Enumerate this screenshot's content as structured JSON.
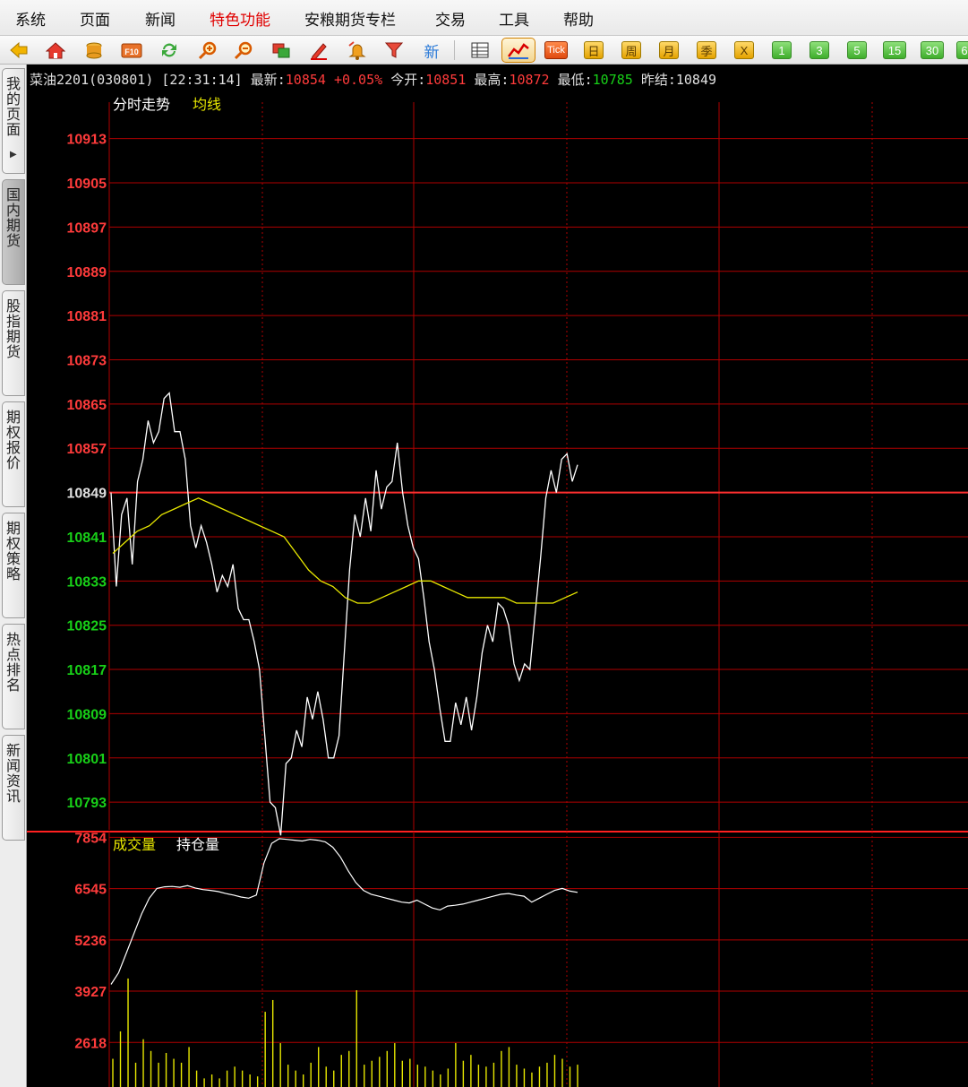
{
  "menu": [
    {
      "label": "系统",
      "highlight": false
    },
    {
      "label": "页面",
      "highlight": false
    },
    {
      "label": "新闻",
      "highlight": false
    },
    {
      "label": "特色功能",
      "highlight": true
    },
    {
      "label": "安粮期货专栏",
      "highlight": false
    },
    {
      "label": "交易",
      "highlight": false
    },
    {
      "label": "工具",
      "highlight": false
    },
    {
      "label": "帮助",
      "highlight": false
    }
  ],
  "toolbar": {
    "icons": [
      "back-arrow-icon",
      "home-icon",
      "database-icon",
      "f10-icon",
      "refresh-icon",
      "zoom-in-icon",
      "zoom-out-icon",
      "window-icon",
      "pencil-icon",
      "bell-icon",
      "filter-icon"
    ],
    "new_label": "新",
    "tick_label": "Tick",
    "periods": [
      "日",
      "周",
      "月",
      "季",
      "X"
    ],
    "minutes": [
      "1",
      "3",
      "5",
      "15",
      "30",
      "6"
    ]
  },
  "sidebar": [
    {
      "label": "我的页面",
      "active": false
    },
    {
      "label": "国内期货",
      "active": true
    },
    {
      "label": "股指期货",
      "active": false
    },
    {
      "label": "期权报价",
      "active": false
    },
    {
      "label": "期权策略",
      "active": false
    },
    {
      "label": "热点排名",
      "active": false
    },
    {
      "label": "新闻资讯",
      "active": false
    }
  ],
  "quote": {
    "name": "菜油2201(030801)",
    "time": "[22:31:14]",
    "latest_label": "最新:",
    "latest": "10854",
    "change": "+0.05%",
    "open_label": "今开:",
    "open": "10851",
    "high_label": "最高:",
    "high": "10872",
    "low_label": "最低:",
    "low": "10785",
    "prev_settle_label": "昨结:",
    "prev_settle": "10849"
  },
  "colors": {
    "grid": "#b00000",
    "price": "#ffffff",
    "avg": "#e8e800",
    "up": "#ff3b3b",
    "down": "#18d018",
    "even": "#e0e0e0"
  },
  "chart_data": [
    {
      "type": "line",
      "legend": [
        "分时走势",
        "均线"
      ],
      "y_ticks": [
        10913,
        10905,
        10897,
        10889,
        10881,
        10873,
        10865,
        10857,
        10849,
        10841,
        10833,
        10825,
        10817,
        10809,
        10801,
        10793
      ],
      "ylim": [
        10788,
        10917
      ],
      "prev_settle": 10849,
      "series": [
        {
          "name": "分时走势",
          "values": [
            10849,
            10832,
            10845,
            10848,
            10836,
            10851,
            10855,
            10862,
            10858,
            10860,
            10866,
            10867,
            10860,
            10860,
            10855,
            10843,
            10839,
            10843,
            10840,
            10836,
            10831,
            10834,
            10832,
            10836,
            10828,
            10826,
            10826,
            10822,
            10817,
            10805,
            10793,
            10792,
            10787,
            10800,
            10801,
            10806,
            10803,
            10812,
            10808,
            10813,
            10808,
            10801,
            10801,
            10805,
            10820,
            10835,
            10845,
            10841,
            10848,
            10842,
            10853,
            10846,
            10850,
            10851,
            10858,
            10849,
            10843,
            10839,
            10837,
            10830,
            10822,
            10817,
            10810,
            10804,
            10804,
            10811,
            10807,
            10812,
            10806,
            10812,
            10820,
            10825,
            10822,
            10829,
            10828,
            10825,
            10818,
            10815,
            10818,
            10817,
            10827,
            10837,
            10848,
            10853,
            10849,
            10855,
            10856,
            10851,
            10854
          ],
          "x_step": 1
        },
        {
          "name": "均线",
          "values": [
            10838,
            10840,
            10842,
            10843,
            10845,
            10846,
            10847,
            10848,
            10847,
            10846,
            10845,
            10844,
            10843,
            10842,
            10841,
            10838,
            10835,
            10833,
            10832,
            10830,
            10829,
            10829,
            10830,
            10831,
            10832,
            10833,
            10833,
            10832,
            10831,
            10830,
            10830,
            10830,
            10830,
            10829,
            10829,
            10829,
            10829,
            10830,
            10831
          ],
          "x_step": 5
        }
      ]
    },
    {
      "type": "bar",
      "legend": [
        "成交量",
        "持仓量"
      ],
      "y_ticks": [
        7854,
        6545,
        5236,
        3927,
        2618
      ],
      "ylim": [
        1480,
        8000
      ],
      "series": [
        {
          "name": "持仓量",
          "values": [
            4100,
            4400,
            4900,
            5400,
            5900,
            6300,
            6550,
            6590,
            6600,
            6580,
            6620,
            6560,
            6520,
            6500,
            6470,
            6420,
            6380,
            6330,
            6300,
            6380,
            7200,
            7700,
            7820,
            7800,
            7780,
            7760,
            7800,
            7780,
            7740,
            7600,
            7350,
            7000,
            6700,
            6500,
            6400,
            6350,
            6300,
            6250,
            6200,
            6180,
            6250,
            6150,
            6050,
            6000,
            6100,
            6120,
            6150,
            6200,
            6250,
            6300,
            6350,
            6400,
            6420,
            6380,
            6350,
            6200,
            6300,
            6400,
            6500,
            6550,
            6480,
            6450
          ],
          "x_step": 8.5
        },
        {
          "name": "成交量",
          "values": [
            2200,
            2900,
            4250,
            2100,
            2700,
            2400,
            2100,
            2350,
            2200,
            2100,
            2500,
            1900,
            1700,
            1800,
            1700,
            1900,
            2000,
            1900,
            1800,
            1750,
            3400,
            3700,
            2600,
            2050,
            1900,
            1800,
            2100,
            2500,
            2000,
            1900,
            2300,
            2400,
            3950,
            2050,
            2150,
            2250,
            2400,
            2600,
            2150,
            2200,
            2050,
            2000,
            1900,
            1800,
            1950,
            2600,
            2150,
            2300,
            2050,
            2000,
            2100,
            2400,
            2500,
            2050,
            1950,
            1850,
            2000,
            2100,
            2300,
            2200,
            2000,
            2050
          ],
          "x_step": 8.5
        }
      ]
    }
  ]
}
